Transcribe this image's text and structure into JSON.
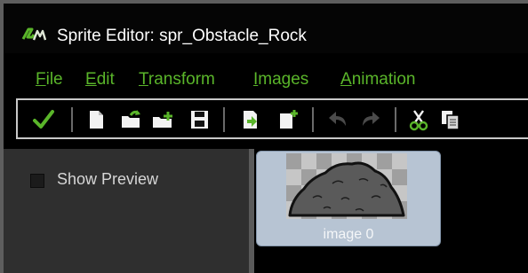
{
  "window": {
    "title": "Sprite Editor: spr_Obstacle_Rock"
  },
  "menu": {
    "items": [
      {
        "first": "F",
        "rest": "ile"
      },
      {
        "first": "E",
        "rest": "dit"
      },
      {
        "first": "T",
        "rest": "ransform"
      },
      {
        "first": "I",
        "rest": "mages"
      },
      {
        "first": "A",
        "rest": "nimation"
      }
    ]
  },
  "toolbar": {
    "icons": [
      "confirm-check-icon",
      "new-file-icon",
      "open-file-icon",
      "open-folder-icon",
      "save-icon",
      "import-icon",
      "add-frame-icon",
      "undo-icon",
      "redo-icon",
      "cut-icon",
      "copy-icon"
    ]
  },
  "panel": {
    "show_preview_label": "Show Preview",
    "show_preview_checked": false
  },
  "frames": [
    {
      "label": "image 0"
    }
  ],
  "colors": {
    "menu_text": "#5ab52a",
    "accent_check": "#5ab52a",
    "frame_selected_bg": "#b7c4d3"
  }
}
